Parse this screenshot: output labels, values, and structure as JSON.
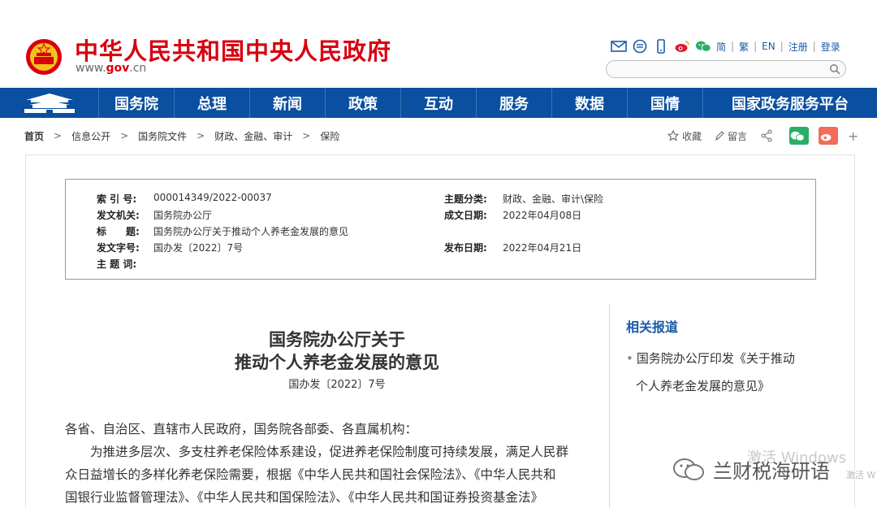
{
  "header": {
    "title": "中华人民共和国中央人民政府",
    "url_prefix": "www.",
    "url_domain": "gov",
    "url_suffix": ".cn",
    "links": [
      "简",
      "繁",
      "EN",
      "注册",
      "登录"
    ],
    "search_placeholder": ""
  },
  "nav": {
    "items": [
      "国务院",
      "总理",
      "新闻",
      "政策",
      "互动",
      "服务",
      "数据",
      "国情",
      "国家政务服务平台"
    ]
  },
  "breadcrumb": [
    "首页",
    "信息公开",
    "国务院文件",
    "财政、金融、审计",
    "保险"
  ],
  "tools": {
    "favorite": "收藏",
    "comment": "留言",
    "plus": "+"
  },
  "info": {
    "index_label": "索 引 号:",
    "index_value": "000014349/2022-00037",
    "category_label": "主题分类:",
    "category_value": "财政、金融、审计\\保险",
    "issuer_label": "发文机关:",
    "issuer_value": "国务院办公厅",
    "date_written_label": "成文日期:",
    "date_written_value": "2022年04月08日",
    "title_label": "标　　题:",
    "title_value": "国务院办公厅关于推动个人养老金发展的意见",
    "doc_no_label": "发文字号:",
    "doc_no_value": "国办发〔2022〕7号",
    "publish_date_label": "发布日期:",
    "publish_date_value": "2022年04月21日",
    "keywords_label": "主 题 词:"
  },
  "related": {
    "title": "相关报道",
    "item_line1": "国务院办公厅印发《关于推动",
    "item_line2": "个人养老金发展的意见》"
  },
  "document": {
    "title_line1": "国务院办公厅关于",
    "title_line2": "推动个人养老金发展的意见",
    "number": "国办发〔2022〕7号",
    "salutation": "各省、自治区、直辖市人民政府，国务院各部委、各直属机构：",
    "para_line1": "为推进多层次、多支柱养老保险体系建设，促进养老保险制度可持续发展，满足人民群",
    "para_line2": "众日益增长的多样化养老保险需要，根据《中华人民共和国社会保险法》、《中华人民共和",
    "para_line3": "国银行业监督管理法》、《中华人民共和国保险法》、《中华人民共和国证券投资基金法》"
  },
  "overlay": {
    "activate": "激活 Windows",
    "wechat_name": "兰财税海研语",
    "activate_small": "激活 W"
  },
  "colors": {
    "brand_red": "#d7000f",
    "nav_blue": "#0b4fa0",
    "link_blue": "#1a5aa8"
  }
}
